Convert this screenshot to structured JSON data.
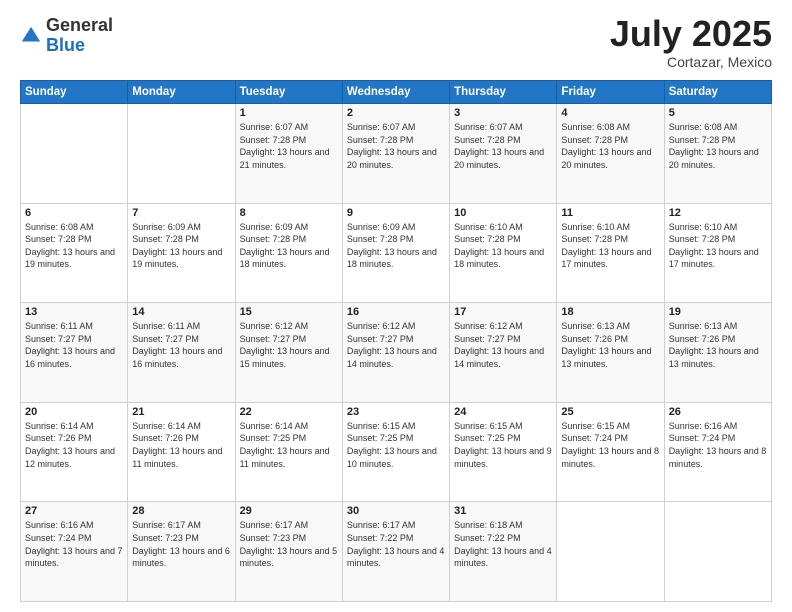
{
  "header": {
    "logo_general": "General",
    "logo_blue": "Blue",
    "month": "July 2025",
    "location": "Cortazar, Mexico"
  },
  "days_of_week": [
    "Sunday",
    "Monday",
    "Tuesday",
    "Wednesday",
    "Thursday",
    "Friday",
    "Saturday"
  ],
  "weeks": [
    [
      {
        "day": "",
        "info": ""
      },
      {
        "day": "",
        "info": ""
      },
      {
        "day": "1",
        "info": "Sunrise: 6:07 AM\nSunset: 7:28 PM\nDaylight: 13 hours and 21 minutes."
      },
      {
        "day": "2",
        "info": "Sunrise: 6:07 AM\nSunset: 7:28 PM\nDaylight: 13 hours and 20 minutes."
      },
      {
        "day": "3",
        "info": "Sunrise: 6:07 AM\nSunset: 7:28 PM\nDaylight: 13 hours and 20 minutes."
      },
      {
        "day": "4",
        "info": "Sunrise: 6:08 AM\nSunset: 7:28 PM\nDaylight: 13 hours and 20 minutes."
      },
      {
        "day": "5",
        "info": "Sunrise: 6:08 AM\nSunset: 7:28 PM\nDaylight: 13 hours and 20 minutes."
      }
    ],
    [
      {
        "day": "6",
        "info": "Sunrise: 6:08 AM\nSunset: 7:28 PM\nDaylight: 13 hours and 19 minutes."
      },
      {
        "day": "7",
        "info": "Sunrise: 6:09 AM\nSunset: 7:28 PM\nDaylight: 13 hours and 19 minutes."
      },
      {
        "day": "8",
        "info": "Sunrise: 6:09 AM\nSunset: 7:28 PM\nDaylight: 13 hours and 18 minutes."
      },
      {
        "day": "9",
        "info": "Sunrise: 6:09 AM\nSunset: 7:28 PM\nDaylight: 13 hours and 18 minutes."
      },
      {
        "day": "10",
        "info": "Sunrise: 6:10 AM\nSunset: 7:28 PM\nDaylight: 13 hours and 18 minutes."
      },
      {
        "day": "11",
        "info": "Sunrise: 6:10 AM\nSunset: 7:28 PM\nDaylight: 13 hours and 17 minutes."
      },
      {
        "day": "12",
        "info": "Sunrise: 6:10 AM\nSunset: 7:28 PM\nDaylight: 13 hours and 17 minutes."
      }
    ],
    [
      {
        "day": "13",
        "info": "Sunrise: 6:11 AM\nSunset: 7:27 PM\nDaylight: 13 hours and 16 minutes."
      },
      {
        "day": "14",
        "info": "Sunrise: 6:11 AM\nSunset: 7:27 PM\nDaylight: 13 hours and 16 minutes."
      },
      {
        "day": "15",
        "info": "Sunrise: 6:12 AM\nSunset: 7:27 PM\nDaylight: 13 hours and 15 minutes."
      },
      {
        "day": "16",
        "info": "Sunrise: 6:12 AM\nSunset: 7:27 PM\nDaylight: 13 hours and 14 minutes."
      },
      {
        "day": "17",
        "info": "Sunrise: 6:12 AM\nSunset: 7:27 PM\nDaylight: 13 hours and 14 minutes."
      },
      {
        "day": "18",
        "info": "Sunrise: 6:13 AM\nSunset: 7:26 PM\nDaylight: 13 hours and 13 minutes."
      },
      {
        "day": "19",
        "info": "Sunrise: 6:13 AM\nSunset: 7:26 PM\nDaylight: 13 hours and 13 minutes."
      }
    ],
    [
      {
        "day": "20",
        "info": "Sunrise: 6:14 AM\nSunset: 7:26 PM\nDaylight: 13 hours and 12 minutes."
      },
      {
        "day": "21",
        "info": "Sunrise: 6:14 AM\nSunset: 7:26 PM\nDaylight: 13 hours and 11 minutes."
      },
      {
        "day": "22",
        "info": "Sunrise: 6:14 AM\nSunset: 7:25 PM\nDaylight: 13 hours and 11 minutes."
      },
      {
        "day": "23",
        "info": "Sunrise: 6:15 AM\nSunset: 7:25 PM\nDaylight: 13 hours and 10 minutes."
      },
      {
        "day": "24",
        "info": "Sunrise: 6:15 AM\nSunset: 7:25 PM\nDaylight: 13 hours and 9 minutes."
      },
      {
        "day": "25",
        "info": "Sunrise: 6:15 AM\nSunset: 7:24 PM\nDaylight: 13 hours and 8 minutes."
      },
      {
        "day": "26",
        "info": "Sunrise: 6:16 AM\nSunset: 7:24 PM\nDaylight: 13 hours and 8 minutes."
      }
    ],
    [
      {
        "day": "27",
        "info": "Sunrise: 6:16 AM\nSunset: 7:24 PM\nDaylight: 13 hours and 7 minutes."
      },
      {
        "day": "28",
        "info": "Sunrise: 6:17 AM\nSunset: 7:23 PM\nDaylight: 13 hours and 6 minutes."
      },
      {
        "day": "29",
        "info": "Sunrise: 6:17 AM\nSunset: 7:23 PM\nDaylight: 13 hours and 5 minutes."
      },
      {
        "day": "30",
        "info": "Sunrise: 6:17 AM\nSunset: 7:22 PM\nDaylight: 13 hours and 4 minutes."
      },
      {
        "day": "31",
        "info": "Sunrise: 6:18 AM\nSunset: 7:22 PM\nDaylight: 13 hours and 4 minutes."
      },
      {
        "day": "",
        "info": ""
      },
      {
        "day": "",
        "info": ""
      }
    ]
  ]
}
